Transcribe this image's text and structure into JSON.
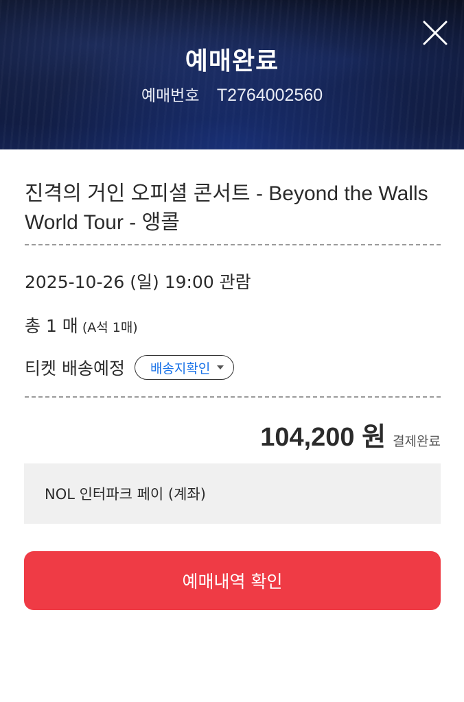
{
  "header": {
    "title": "예매완료",
    "booking_label": "예매번호",
    "booking_number": "T2764002560",
    "close_icon": "close-icon"
  },
  "event": {
    "title": "진격의 거인 오피셜 콘서트 - Beyond the Walls World Tour - 앵콜"
  },
  "details": {
    "date": "2025-10-26 (일) 19:00 관람",
    "count_main": "총 1 매",
    "count_sub": "(A석 1매)",
    "delivery_text": "티켓 배송예정",
    "delivery_dropdown": "배송지확인"
  },
  "payment": {
    "amount": "104,200 원",
    "status": "결제완료",
    "method": "NOL 인터파크 페이 (계좌)"
  },
  "actions": {
    "primary_label": "예매내역 확인"
  },
  "colors": {
    "accent": "#ef3b45",
    "link": "#1a73e8"
  }
}
